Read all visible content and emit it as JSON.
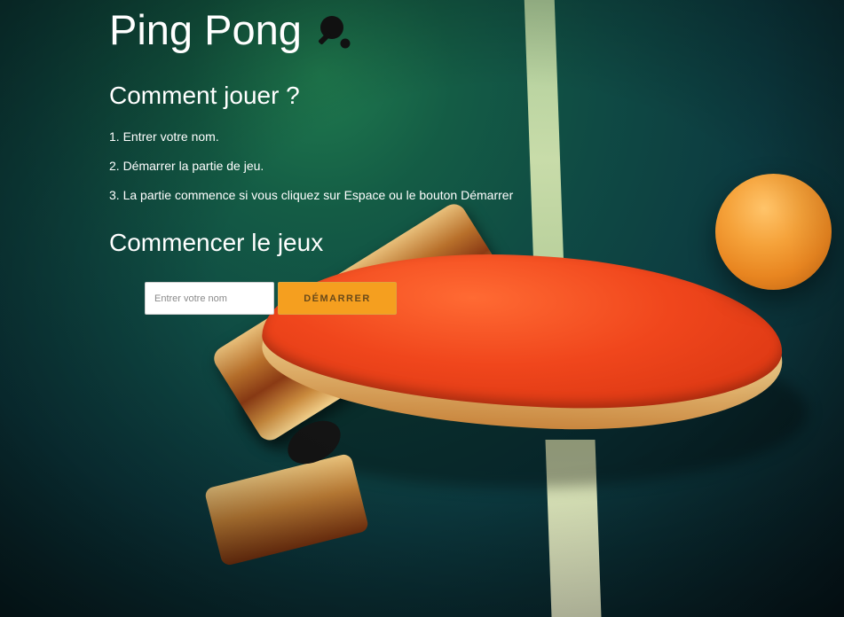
{
  "header": {
    "title": "Ping Pong",
    "icon": "ping-pong-paddle-icon"
  },
  "instructions": {
    "heading": "Comment jouer ?",
    "steps": [
      "1. Entrer votre nom.",
      "2. Démarrer la partie de jeu.",
      "3. La partie commence si vous cliquez sur Espace ou le bouton Démarrer"
    ]
  },
  "start": {
    "heading": "Commencer le jeux",
    "name_placeholder": "Entrer votre nom",
    "name_value": "",
    "button_label": "DÉMARRER"
  },
  "colors": {
    "accent": "#f59f1f",
    "text": "#ffffff"
  }
}
